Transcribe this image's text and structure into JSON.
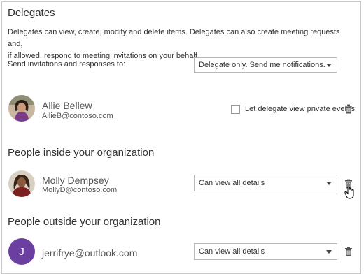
{
  "delegates": {
    "title": "Delegates",
    "description_line1": "Delegates can view, create, modify and delete items. Delegates can also create meeting requests and,",
    "description_line2": "if allowed, respond to meeting invitations on your behalf.",
    "send_label": "Send invitations and responses to:",
    "send_select_value": "Delegate only. Send me notifications.",
    "delegate": {
      "name": "Allie Bellew",
      "email": "AllieB@contoso.com",
      "private_checkbox_label": "Let delegate view private events",
      "private_checked": false
    }
  },
  "inside_org": {
    "title": "People inside your organization",
    "person": {
      "name": "Molly Dempsey",
      "email": "MollyD@contoso.com",
      "permission": "Can view all details"
    }
  },
  "outside_org": {
    "title": "People outside your organization",
    "person": {
      "initial": "J",
      "email": "jerrifrye@outlook.com",
      "permission": "Can view all details",
      "avatar_color": "#6b3fa0"
    }
  }
}
